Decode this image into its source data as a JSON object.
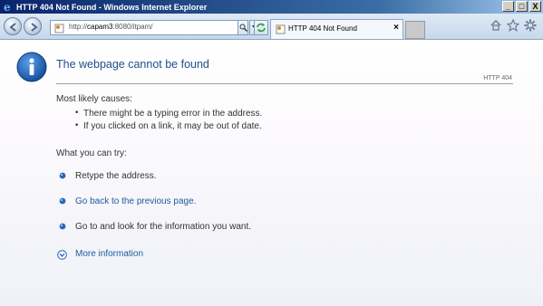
{
  "window": {
    "title": "HTTP 404 Not Found - Windows Internet Explorer",
    "minimize_glyph": "_",
    "maximize_glyph": "□",
    "close_glyph": "X"
  },
  "toolbar": {
    "address_prefix": "http://",
    "address_host": "capam3",
    "address_rest": ":8080/itpam/",
    "tab_label": "HTTP 404 Not Found",
    "tab_close": "×"
  },
  "page": {
    "heading": "The webpage cannot be found",
    "code": "HTTP 404",
    "causes_title": "Most likely causes:",
    "causes": [
      "There might be a typing error in the address.",
      "If you clicked on a link, it may be out of date."
    ],
    "try_title": "What you can try:",
    "tries": [
      "Retype the address.",
      "Go back to the previous page.",
      "Go to  and look for the information you want."
    ],
    "more_info": "More information"
  },
  "colors": {
    "heading": "#1f4e8c",
    "link": "#1f5a9e",
    "titlebar": "#0a246a"
  }
}
